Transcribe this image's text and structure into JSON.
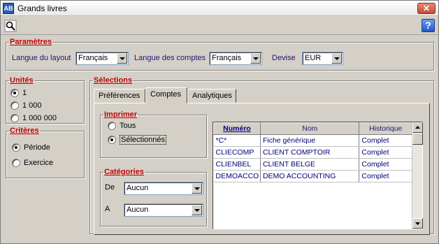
{
  "window": {
    "title": "Grands livres",
    "app_icon": "AB"
  },
  "toolbar": {
    "search_icon": "search-icon",
    "help_label": "?"
  },
  "parametres": {
    "legend": "Paramètres",
    "langue_layout_label": "Langue du layout",
    "langue_layout_value": "Français",
    "langue_comptes_label": "Langue des comptes",
    "langue_comptes_value": "Français",
    "devise_label": "Devise",
    "devise_value": "EUR"
  },
  "unites": {
    "legend": "Unités",
    "options": [
      "1",
      "1 000",
      "1 000 000"
    ],
    "selected": 0
  },
  "criteres": {
    "legend": "Critères",
    "options": [
      "Période",
      "Exercice"
    ],
    "selected": 0
  },
  "selections": {
    "legend": "Sélections",
    "tabs": [
      "Préférences",
      "Comptes",
      "Analytiques"
    ],
    "active_tab": 1
  },
  "imprimer": {
    "legend": "Imprimer",
    "options": [
      "Tous",
      "Sélectionnés"
    ],
    "selected": 1
  },
  "categories": {
    "legend": "Catégories",
    "de_label": "De",
    "de_value": "Aucun",
    "a_label": "A",
    "a_value": "Aucun"
  },
  "accounts_table": {
    "columns": [
      "Numéro",
      "Nom",
      "Historique"
    ],
    "rows": [
      [
        "*C*",
        "Fiche générique",
        "Complet"
      ],
      [
        "CLIECOMP",
        "CLIENT COMPTOIR",
        "Complet"
      ],
      [
        "CLIENBEL",
        "CLIENT BELGE",
        "Complet"
      ],
      [
        "DEMOACCO",
        "DEMO ACCOUNTING",
        "Complet"
      ]
    ]
  }
}
